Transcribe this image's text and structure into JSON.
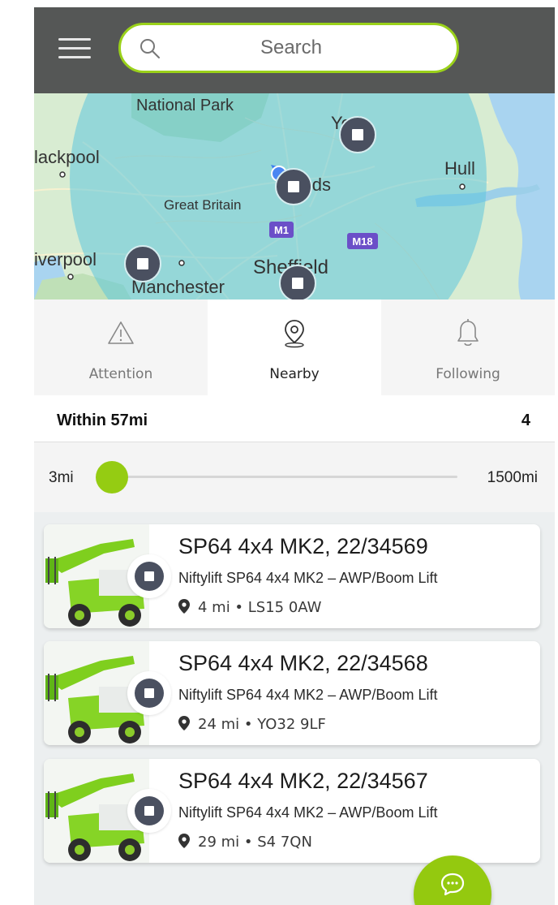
{
  "header": {
    "menu_icon": "hamburger-menu-icon",
    "search": {
      "placeholder": "Search",
      "value": "",
      "icon": "search-icon"
    }
  },
  "map": {
    "labels": {
      "national_park": "National Park",
      "york": "York",
      "blackpool": "lackpool",
      "leeds": "Leeds",
      "hull": "Hull",
      "great_britain": "Great Britain",
      "m1": "M1",
      "m18": "M18",
      "liverpool": "iverpool",
      "sheffield": "Sheffield",
      "manchester": "Manchester"
    },
    "colors": {
      "land": "#c9e6c1",
      "water": "#a9d4f0",
      "radius": "#5fc7dd",
      "marker": "#4a5060"
    }
  },
  "tabs": [
    {
      "label": "Attention",
      "icon": "warning-triangle-icon",
      "active": false
    },
    {
      "label": "Nearby",
      "icon": "location-pin-icon",
      "active": true
    },
    {
      "label": "Following",
      "icon": "bell-icon",
      "active": false
    }
  ],
  "list": {
    "radius_title": "Within 57mi",
    "count": "4",
    "slider": {
      "min_label": "3mi",
      "max_label": "1500mi",
      "value_mi": 57
    },
    "items": [
      {
        "title": "SP64 4x4 MK2, 22/34569",
        "subtitle": "Niftylift SP64 4x4 MK2 – AWP/Boom Lift",
        "meta": "4 mi • LS15 0AW"
      },
      {
        "title": "SP64 4x4 MK2, 22/34568",
        "subtitle": "Niftylift SP64 4x4 MK2 – AWP/Boom Lift",
        "meta": "24 mi • YO32 9LF"
      },
      {
        "title": "SP64 4x4 MK2, 22/34567",
        "subtitle": "Niftylift SP64 4x4 MK2 – AWP/Boom Lift",
        "meta": "29 mi • S4 7QN"
      }
    ]
  },
  "fab": {
    "icon": "chat-bubble-icon"
  },
  "colors": {
    "accent": "#95cc12",
    "header": "#555756",
    "marker": "#4a5060"
  }
}
